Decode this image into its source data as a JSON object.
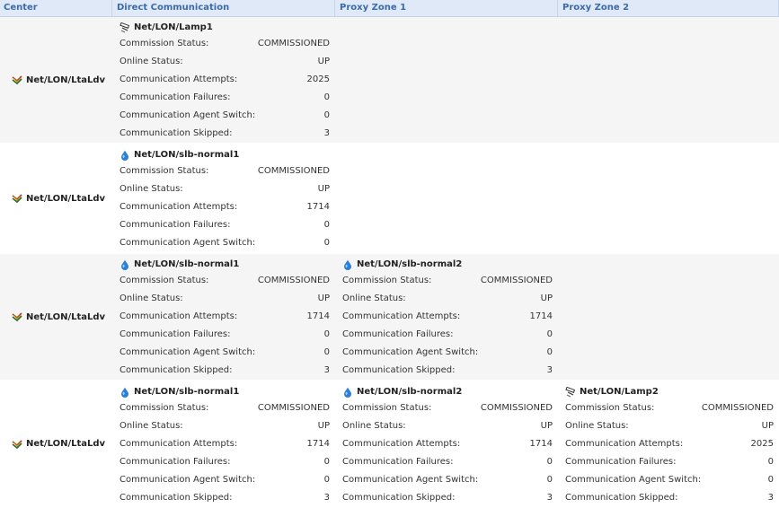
{
  "columns": [
    "Center",
    "Direct Communication",
    "Proxy Zone 1",
    "Proxy Zone 2"
  ],
  "labels": {
    "commission": "Commission Status:",
    "online": "Online Status:",
    "attempts": "Communication Attempts:",
    "failures": "Communication Failures:",
    "agent_switch": "Communication Agent Switch:",
    "skipped": "Communication Skipped:"
  },
  "rows": [
    {
      "center": "Net/LON/LtaLdv",
      "direct": {
        "name": "Net/LON/Lamp1",
        "icon": "lamp-icon",
        "commission": "COMMISSIONED",
        "online": "UP",
        "attempts": "2025",
        "failures": "0",
        "agent_switch": "0",
        "skipped": "3"
      },
      "proxy1": null,
      "proxy2": null
    },
    {
      "center": "Net/LON/LtaLdv",
      "direct": {
        "name": "Net/LON/slb-normal1",
        "icon": "drop-icon",
        "commission": "COMMISSIONED",
        "online": "UP",
        "attempts": "1714",
        "failures": "0",
        "agent_switch": "0"
      },
      "proxy1": null,
      "proxy2": null
    },
    {
      "center": "Net/LON/LtaLdv",
      "direct": {
        "name": "Net/LON/slb-normal1",
        "icon": "drop-icon",
        "commission": "COMMISSIONED",
        "online": "UP",
        "attempts": "1714",
        "failures": "0",
        "agent_switch": "0",
        "skipped": "3"
      },
      "proxy1": {
        "name": "Net/LON/slb-normal2",
        "icon": "drop-icon",
        "commission": "COMMISSIONED",
        "online": "UP",
        "attempts": "1714",
        "failures": "0",
        "agent_switch": "0",
        "skipped": "3"
      },
      "proxy2": null
    },
    {
      "center": "Net/LON/LtaLdv",
      "direct": {
        "name": "Net/LON/slb-normal1",
        "icon": "drop-icon",
        "commission": "COMMISSIONED",
        "online": "UP",
        "attempts": "1714",
        "failures": "0",
        "agent_switch": "0",
        "skipped": "3"
      },
      "proxy1": {
        "name": "Net/LON/slb-normal2",
        "icon": "drop-icon",
        "commission": "COMMISSIONED",
        "online": "UP",
        "attempts": "1714",
        "failures": "0",
        "agent_switch": "0",
        "skipped": "3"
      },
      "proxy2": {
        "name": "Net/LON/Lamp2",
        "icon": "lamp-icon",
        "commission": "COMMISSIONED",
        "online": "UP",
        "attempts": "2025",
        "failures": "0",
        "agent_switch": "0",
        "skipped": "3"
      }
    }
  ],
  "colors": {
    "header_bg": "#dfe9f7",
    "header_text": "#3d6aa8",
    "shade_bg": "#f5f5f5",
    "drop_icon": "#2a7fd6"
  }
}
